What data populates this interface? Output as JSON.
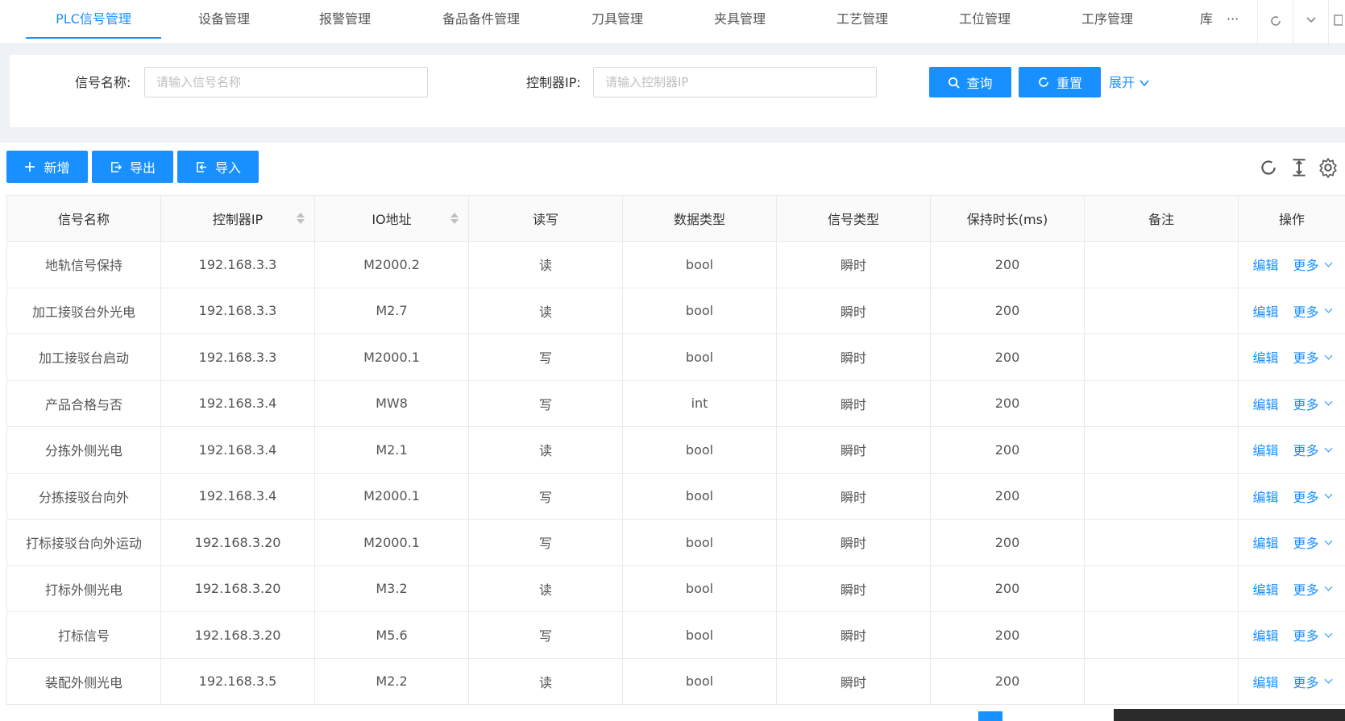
{
  "tabs": [
    {
      "label": "PLC信号管理",
      "active": true
    },
    {
      "label": "设备管理"
    },
    {
      "label": "报警管理"
    },
    {
      "label": "备品备件管理"
    },
    {
      "label": "刀具管理"
    },
    {
      "label": "夹具管理"
    },
    {
      "label": "工艺管理"
    },
    {
      "label": "工位管理"
    },
    {
      "label": "工序管理"
    },
    {
      "label": "库"
    }
  ],
  "tabbar": {
    "more": "···"
  },
  "search": {
    "signal_label": "信号名称:",
    "signal_placeholder": "请输入信号名称",
    "ip_label": "控制器IP:",
    "ip_placeholder": "请输入控制器IP",
    "query": "查询",
    "reset": "重置",
    "expand": "展开"
  },
  "toolbar": {
    "add": "新增",
    "export": "导出",
    "import": "导入"
  },
  "table": {
    "columns": [
      "信号名称",
      "控制器IP",
      "IO地址",
      "读写",
      "数据类型",
      "信号类型",
      "保持时长(ms)",
      "备注",
      "操作"
    ],
    "rows": [
      {
        "name": "地轨信号保持",
        "ip": "192.168.3.3",
        "io": "M2000.2",
        "rw": "读",
        "dtype": "bool",
        "stype": "瞬时",
        "hold": "200",
        "remark": ""
      },
      {
        "name": "加工接驳台外光电",
        "ip": "192.168.3.3",
        "io": "M2.7",
        "rw": "读",
        "dtype": "bool",
        "stype": "瞬时",
        "hold": "200",
        "remark": ""
      },
      {
        "name": "加工接驳台启动",
        "ip": "192.168.3.3",
        "io": "M2000.1",
        "rw": "写",
        "dtype": "bool",
        "stype": "瞬时",
        "hold": "200",
        "remark": ""
      },
      {
        "name": "产品合格与否",
        "ip": "192.168.3.4",
        "io": "MW8",
        "rw": "写",
        "dtype": "int",
        "stype": "瞬时",
        "hold": "200",
        "remark": ""
      },
      {
        "name": "分拣外侧光电",
        "ip": "192.168.3.4",
        "io": "M2.1",
        "rw": "读",
        "dtype": "bool",
        "stype": "瞬时",
        "hold": "200",
        "remark": ""
      },
      {
        "name": "分拣接驳台向外",
        "ip": "192.168.3.4",
        "io": "M2000.1",
        "rw": "写",
        "dtype": "bool",
        "stype": "瞬时",
        "hold": "200",
        "remark": ""
      },
      {
        "name": "打标接驳台向外运动",
        "ip": "192.168.3.20",
        "io": "M2000.1",
        "rw": "写",
        "dtype": "bool",
        "stype": "瞬时",
        "hold": "200",
        "remark": ""
      },
      {
        "name": "打标外侧光电",
        "ip": "192.168.3.20",
        "io": "M3.2",
        "rw": "读",
        "dtype": "bool",
        "stype": "瞬时",
        "hold": "200",
        "remark": ""
      },
      {
        "name": "打标信号",
        "ip": "192.168.3.20",
        "io": "M5.6",
        "rw": "写",
        "dtype": "bool",
        "stype": "瞬时",
        "hold": "200",
        "remark": ""
      },
      {
        "name": "装配外侧光电",
        "ip": "192.168.3.5",
        "io": "M2.2",
        "rw": "读",
        "dtype": "bool",
        "stype": "瞬时",
        "hold": "200",
        "remark": ""
      }
    ],
    "row_actions": {
      "edit": "编辑",
      "more": "更多"
    }
  },
  "colors": {
    "primary": "#1890ff",
    "border": "#eaeaea",
    "header_bg": "#fafafa"
  }
}
